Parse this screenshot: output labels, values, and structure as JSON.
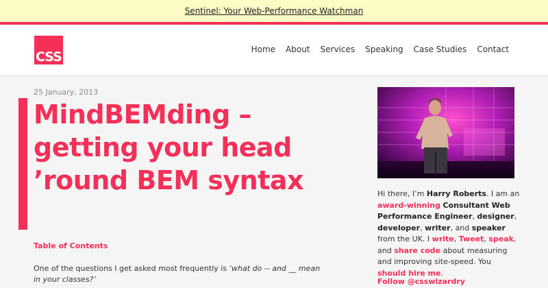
{
  "banner": {
    "link": "Sentinel: Your Web-Performance Watchman"
  },
  "logo": {
    "text": "CSS"
  },
  "nav": [
    "Home",
    "About",
    "Services",
    "Speaking",
    "Case Studies",
    "Contact"
  ],
  "post": {
    "date": "25 January, 2013",
    "title": "MindBEMding – getting your head ’round BEM syntax",
    "toc": "Table of Contents",
    "intro_plain": "One of the questions I get asked most frequently is ",
    "intro_quote": "‘what do -- and __ mean in your classes?’"
  },
  "sidebar": {
    "bio": {
      "t1": "Hi there, I’m ",
      "name": "Harry Roberts",
      "t2": ". I am an ",
      "award": "award-winning",
      "t3": " ",
      "role": "Consultant Web Performance Engineer",
      "t4": ", ",
      "designer": "designer",
      "t5": ", ",
      "developer": "developer",
      "t6": ", ",
      "writer": "writer",
      "t7": ", and ",
      "speaker": "speaker",
      "t8": " from the UK. I ",
      "write": "write",
      "t9": ", ",
      "tweet": "Tweet",
      "t10": ", ",
      "speak": "speak",
      "t11": ", and ",
      "share": "share code",
      "t12": " about measuring and improving site-speed. You ",
      "hire": "should hire me",
      "t13": "."
    },
    "follow": "Follow @csswizardry"
  },
  "colors": {
    "accent": "#f43059",
    "banner_bg": "#fdfbc6",
    "page_bg": "#f5f5f5"
  }
}
